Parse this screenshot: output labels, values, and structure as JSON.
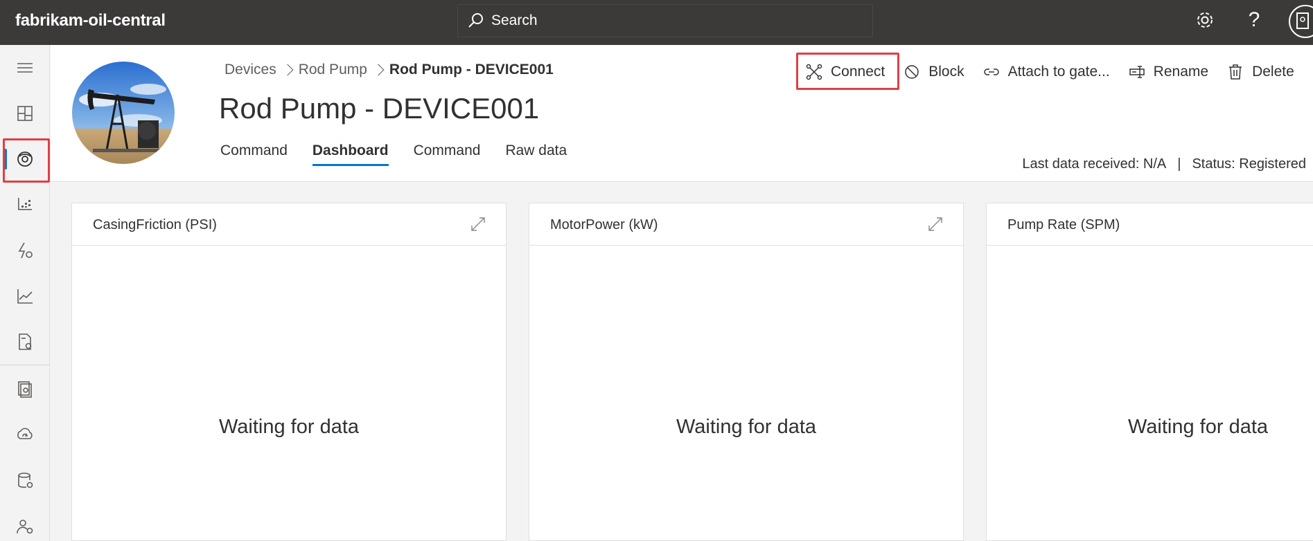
{
  "topbar": {
    "app_title": "fabrikam-oil-central",
    "search_placeholder": "Search",
    "icons": [
      "search-icon",
      "settings-icon",
      "help-icon",
      "user-avatar"
    ]
  },
  "rail": {
    "items": [
      "menu-icon",
      "dashboard-icon",
      "devices-icon",
      "device-groups-icon",
      "rules-icon",
      "analytics-icon",
      "jobs-icon",
      "device-templates-icon",
      "data-export-icon",
      "data-explorer-icon",
      "permissions-icon"
    ],
    "active_index": 2
  },
  "header": {
    "breadcrumb": [
      "Devices",
      "Rod Pump",
      "Rod Pump - DEVICE001"
    ],
    "title": "Rod Pump - DEVICE001",
    "tabs": [
      "Command",
      "Dashboard",
      "Command",
      "Raw data"
    ],
    "active_tab": 1,
    "toolbar": {
      "connect": "Connect",
      "block": "Block",
      "attach": "Attach to gate...",
      "rename": "Rename",
      "delete": "Delete"
    },
    "status": {
      "last_data": "Last data received: N/A",
      "separator": "|",
      "status": "Status: Registered"
    }
  },
  "tiles": [
    {
      "title": "CasingFriction (PSI)",
      "body": "Waiting for data"
    },
    {
      "title": "MotorPower (kW)",
      "body": "Waiting for data"
    },
    {
      "title": "Pump Rate (SPM)",
      "body": "Waiting for data"
    }
  ],
  "colors": {
    "topbar_bg": "#3b3a39",
    "accent": "#0078d4",
    "highlight": "#e03f45"
  }
}
